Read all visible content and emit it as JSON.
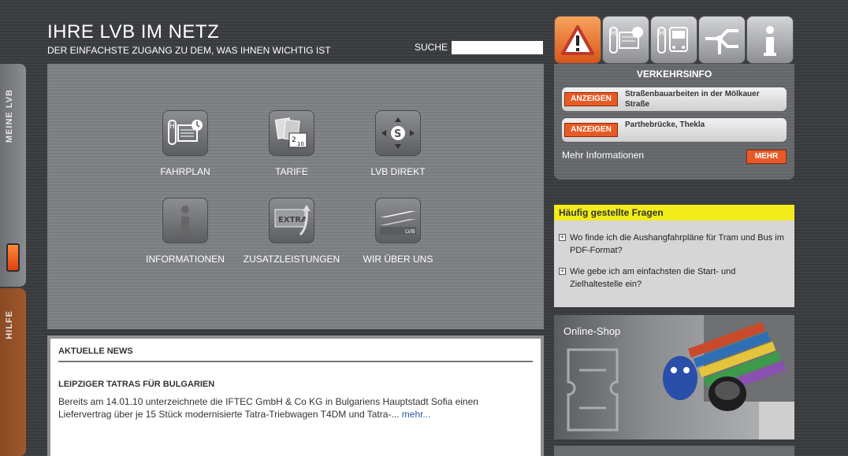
{
  "header": {
    "title": "IHRE LVB IM NETZ",
    "subtitle": "DER EINFACHSTE ZUGANG ZU DEM, WAS IHNEN WICHTIG IST",
    "search_label": "SUCHE",
    "search_value": ""
  },
  "side_tabs": [
    {
      "label": "MEINE LVB"
    },
    {
      "label": "HILFE"
    }
  ],
  "nav_tiles": [
    {
      "label": "FAHRPLAN",
      "icon": "timetable-icon"
    },
    {
      "label": "TARIFE",
      "icon": "tickets-icon"
    },
    {
      "label": "LVB DIREKT",
      "icon": "direct-icon"
    },
    {
      "label": "INFORMATIONEN",
      "icon": "info-icon"
    },
    {
      "label": "ZUSATZLEISTUNGEN",
      "icon": "extra-icon"
    },
    {
      "label": "WIR ÜBER UNS",
      "icon": "lvb-logo-icon"
    }
  ],
  "top_icons": [
    "warning-icon",
    "timetable-icon",
    "tram-icon",
    "network-icon",
    "info-icon"
  ],
  "traffic": {
    "title": "VERKEHRSINFO",
    "button_label": "ANZEIGEN",
    "items": [
      {
        "text": "Straßenbauarbeiten in der Mölkauer Straße"
      },
      {
        "text": "Parthebrücke, Thekla"
      }
    ],
    "more_text": "Mehr Informationen",
    "more_button": "MEHR"
  },
  "faq": {
    "title": "Häufig gestellte Fragen",
    "items": [
      "Wo finde ich die Aushangfahrpläne für Tram und Bus im PDF-Format?",
      "Wie gebe ich am einfachsten die Start- und Zielhaltestelle ein?"
    ]
  },
  "shop": {
    "title": "Online-Shop"
  },
  "news": {
    "header": "AKTUELLE NEWS",
    "headline": "LEIPZIGER TATRAS FÜR BULGARIEN",
    "text": "Bereits am 14.01.10 unterzeichnete die IFTEC GmbH & Co KG in Bulgariens Hauptstadt Sofia einen Liefervertrag über je 15 Stück modernisierte Tatra-Triebwagen T4DM und Tatra-...",
    "more": "mehr..."
  },
  "colors": {
    "accent_orange": "#e85a25",
    "faq_yellow": "#f2ec1a",
    "link_blue": "#2a5aa8"
  }
}
